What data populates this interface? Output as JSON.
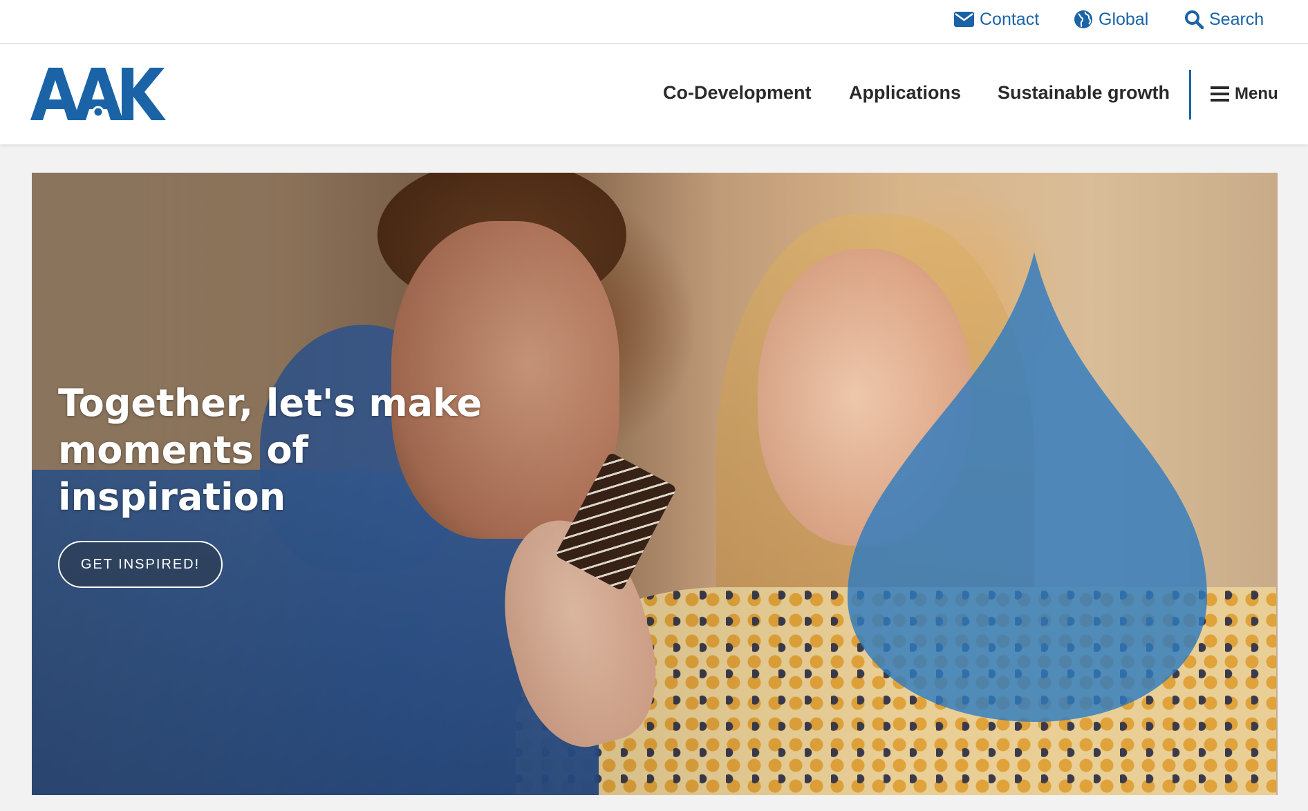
{
  "utility": {
    "contact_label": "Contact",
    "global_label": "Global",
    "search_label": "Search"
  },
  "header": {
    "logo_text": "AAK",
    "nav": [
      {
        "label": "Co-Development"
      },
      {
        "label": "Applications"
      },
      {
        "label": "Sustainable growth"
      }
    ],
    "menu_label": "Menu"
  },
  "hero": {
    "title": "Together, let's make moments of inspiration",
    "cta_label": "GET INSPIRED!"
  },
  "colors": {
    "brand_blue": "#1a63a6",
    "drop_blue": "#2f7bbf",
    "nav_text": "#2a2a2a",
    "page_bg": "#f2f2f2"
  },
  "icons": {
    "contact": "envelope-icon",
    "global": "globe-icon",
    "search": "search-icon",
    "menu": "hamburger-icon"
  }
}
